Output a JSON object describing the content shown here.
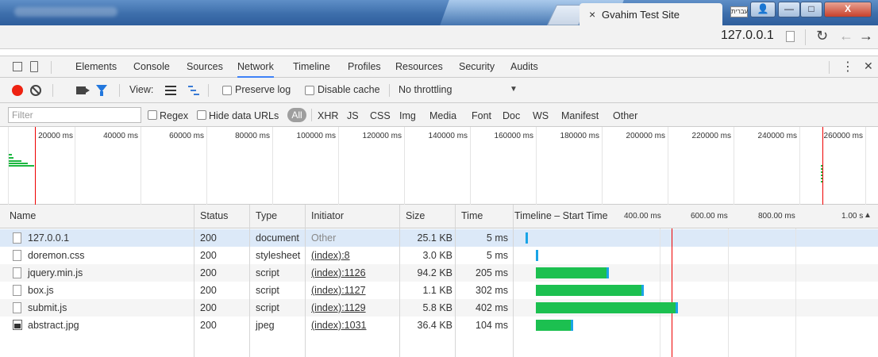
{
  "window": {
    "tab_close": "×",
    "tab_title": "Gvahim Test Site",
    "lang_badge": "עברית",
    "buttons": {
      "user": "👤",
      "minimize": "—",
      "maximize": "□",
      "close": "X"
    }
  },
  "address_bar": {
    "url": "127.0.0.1",
    "reload": "↻",
    "back": "←",
    "forward": "→"
  },
  "devtools": {
    "tabs": [
      "Elements",
      "Console",
      "Sources",
      "Network",
      "Timeline",
      "Profiles",
      "Resources",
      "Security",
      "Audits"
    ],
    "active_tab": "Network",
    "kebab": "⋮",
    "close": "✕"
  },
  "toolbar": {
    "view_label": "View:",
    "preserve_log": "Preserve log",
    "disable_cache": "Disable cache",
    "throttling": "No throttling",
    "throttle_arrow": "▼"
  },
  "filter_bar": {
    "placeholder": "Filter",
    "regex": "Regex",
    "hide_data_urls": "Hide data URLs",
    "all": "All",
    "types": [
      "XHR",
      "JS",
      "CSS",
      "Img",
      "Media",
      "Font",
      "Doc",
      "WS",
      "Manifest",
      "Other"
    ]
  },
  "overview": {
    "ticks": [
      "20000 ms",
      "40000 ms",
      "60000 ms",
      "80000 ms",
      "100000 ms",
      "120000 ms",
      "140000 ms",
      "160000 ms",
      "180000 ms",
      "200000 ms",
      "220000 ms",
      "240000 ms",
      "260000 ms"
    ]
  },
  "table": {
    "headers": {
      "name": "Name",
      "status": "Status",
      "type": "Type",
      "initiator": "Initiator",
      "size": "Size",
      "time": "Time",
      "timeline": "Timeline – Start Time"
    },
    "waterfall_ticks": [
      "400.00 ms",
      "600.00 ms",
      "800.00 ms",
      "1.00 s"
    ],
    "sort_arrow": "▲",
    "rows": [
      {
        "name": "127.0.0.1",
        "status": "200",
        "type": "document",
        "initiator": "Other",
        "size": "25.1 KB",
        "time": "5 ms",
        "icon": "document-icon"
      },
      {
        "name": "doremon.css",
        "status": "200",
        "type": "stylesheet",
        "initiator": "(index):8",
        "size": "3.0 KB",
        "time": "5 ms",
        "icon": "document-icon"
      },
      {
        "name": "jquery.min.js",
        "status": "200",
        "type": "script",
        "initiator": "(index):1126",
        "size": "94.2 KB",
        "time": "205 ms",
        "icon": "document-icon"
      },
      {
        "name": "box.js",
        "status": "200",
        "type": "script",
        "initiator": "(index):1127",
        "size": "1.1 KB",
        "time": "302 ms",
        "icon": "document-icon"
      },
      {
        "name": "submit.js",
        "status": "200",
        "type": "script",
        "initiator": "(index):1129",
        "size": "5.8 KB",
        "time": "402 ms",
        "icon": "document-icon"
      },
      {
        "name": "abstract.jpg",
        "status": "200",
        "type": "jpeg",
        "initiator": "(index):1031",
        "size": "36.4 KB",
        "time": "104 ms",
        "icon": "image-icon"
      }
    ]
  },
  "colors": {
    "record": "#e21111",
    "waterfall_green": "#1cc050",
    "waterfall_blue": "#19a4e6",
    "active_tab_underline": "#3e82f7",
    "selected_row": "#dce9f8"
  }
}
